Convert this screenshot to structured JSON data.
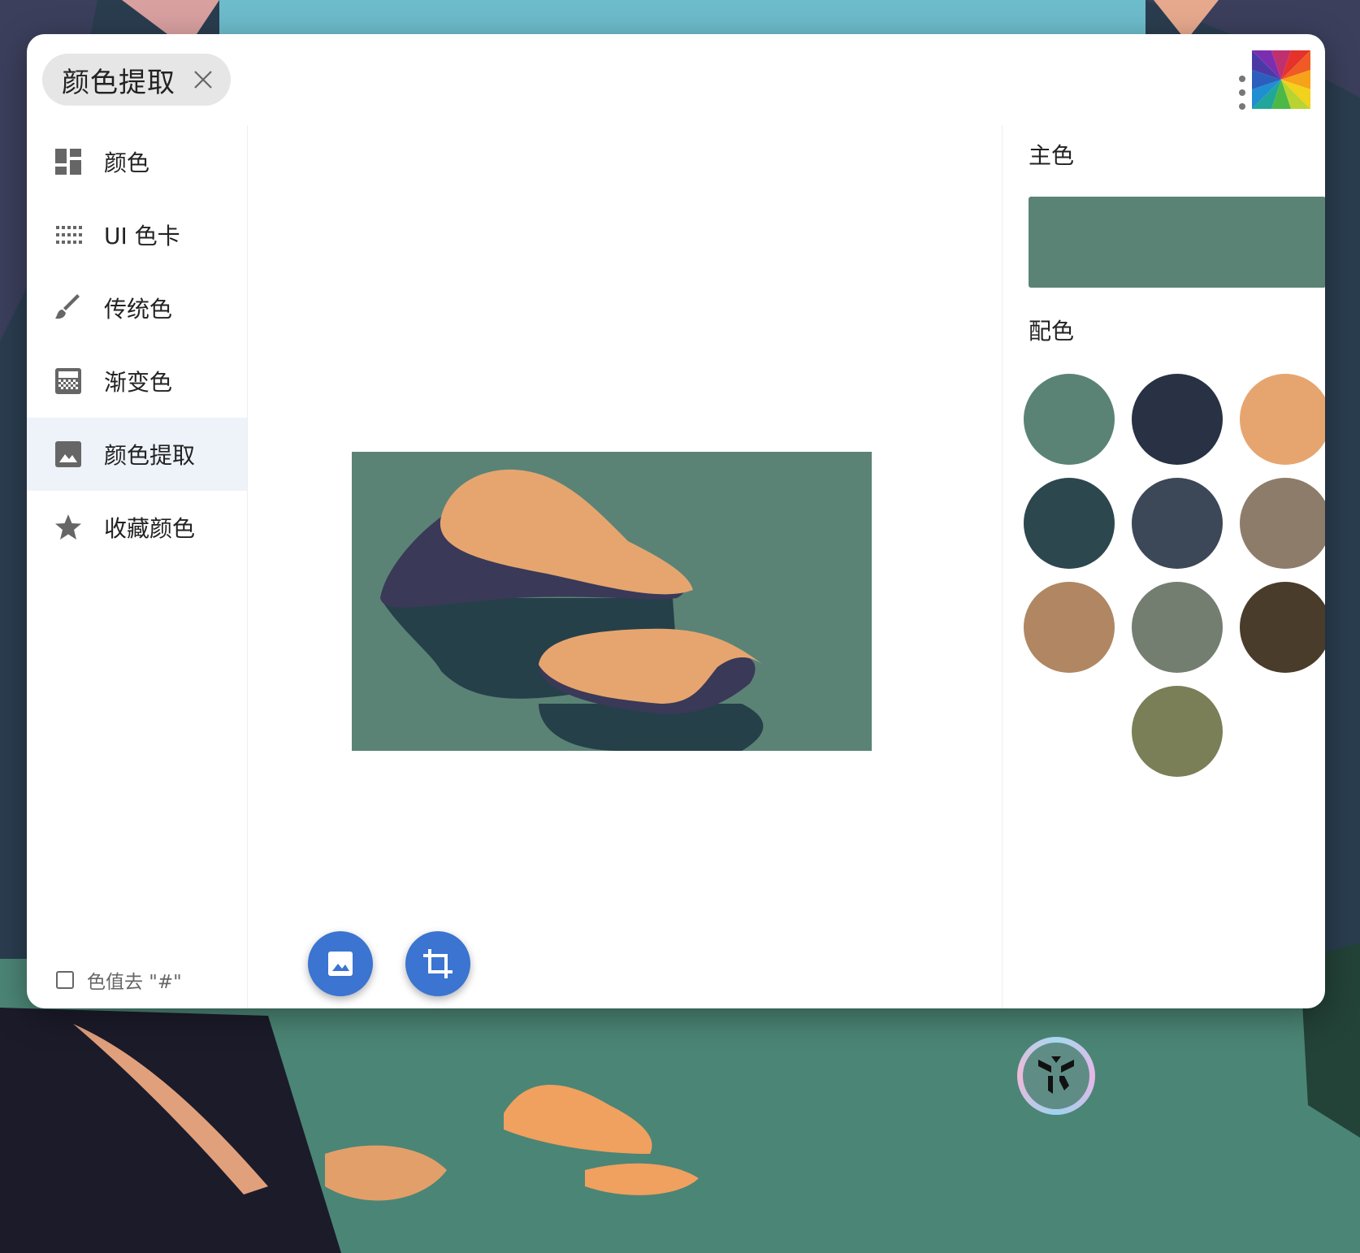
{
  "window": {
    "tab_title": "颜色提取"
  },
  "sidebar": {
    "items": [
      {
        "label": "颜色",
        "icon": "dashboard-icon",
        "active": false
      },
      {
        "label": "UI 色卡",
        "icon": "grid-dots-icon",
        "active": false
      },
      {
        "label": "传统色",
        "icon": "brush-icon",
        "active": false
      },
      {
        "label": "渐变色",
        "icon": "gradient-icon",
        "active": false
      },
      {
        "label": "颜色提取",
        "icon": "image-icon",
        "active": true
      },
      {
        "label": "收藏颜色",
        "icon": "star-icon",
        "active": false
      }
    ],
    "hash_toggle_label": "色值去 \"#\"",
    "hash_toggle_checked": false
  },
  "main": {
    "buttons": [
      {
        "icon": "image-icon",
        "action": "choose-image"
      },
      {
        "icon": "crop-icon",
        "action": "crop-image"
      }
    ]
  },
  "palette": {
    "primary_title": "主色",
    "primary_color": "#5a8376",
    "scheme_title": "配色",
    "colors": [
      "#5a8376",
      "#283244",
      "#e6a56f",
      "#2d474e",
      "#3c4858",
      "#8e7c6a",
      "#b08762",
      "#737e71",
      "#4a3c2a",
      "#7a7f57"
    ]
  },
  "colors": {
    "accent": "#3b74d1",
    "active_nav_bg": "#eef2f9",
    "image_bg": "#5a8376",
    "rock_top": "#e6a56f",
    "rock_side": "#3a3958"
  }
}
